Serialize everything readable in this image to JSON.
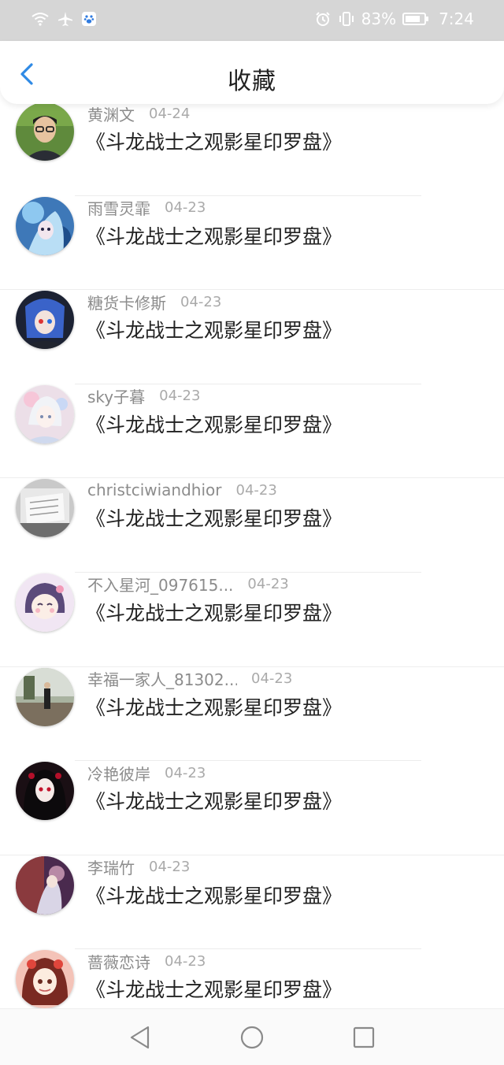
{
  "status_bar": {
    "battery_text": "83%",
    "battery_level": 0.83,
    "time": "7:24"
  },
  "header": {
    "title": "收藏"
  },
  "favorites": [
    {
      "user": "黄渊文",
      "date": "04-24",
      "title": "《斗龙战士之观影星印罗盘》"
    },
    {
      "user": "雨雪灵霏",
      "date": "04-23",
      "title": "《斗龙战士之观影星印罗盘》"
    },
    {
      "user": "糖货卡修斯",
      "date": "04-23",
      "title": "《斗龙战士之观影星印罗盘》"
    },
    {
      "user": "sky子暮",
      "date": "04-23",
      "title": "《斗龙战士之观影星印罗盘》"
    },
    {
      "user": "christciwiandhior",
      "date": "04-23",
      "title": "《斗龙战士之观影星印罗盘》"
    },
    {
      "user": "不入星河_097615...",
      "date": "04-23",
      "title": "《斗龙战士之观影星印罗盘》"
    },
    {
      "user": "幸福一家人_81302...",
      "date": "04-23",
      "title": "《斗龙战士之观影星印罗盘》"
    },
    {
      "user": "冷艳彼岸",
      "date": "04-23",
      "title": "《斗龙战士之观影星印罗盘》"
    },
    {
      "user": "李瑞竹",
      "date": "04-23",
      "title": "《斗龙战士之观影星印罗盘》"
    },
    {
      "user": "蔷薇恋诗",
      "date": "04-23",
      "title": "《斗龙战士之观影星印罗盘》"
    }
  ],
  "colors": {
    "accent": "#2f8ae5",
    "status_bar_bg": "#d6d6d6",
    "username": "#8c8c8c",
    "title": "#222222"
  },
  "icons": {
    "back": "chevron-left-icon",
    "nav_back": "triangle-back-icon",
    "nav_home": "circle-home-icon",
    "nav_recent": "square-recent-icon"
  }
}
